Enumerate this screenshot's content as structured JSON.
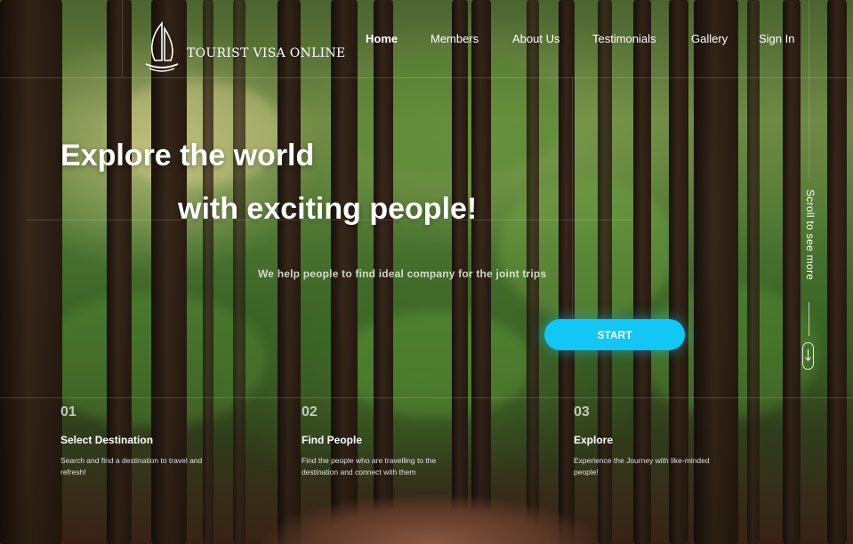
{
  "header": {
    "logo_text": "TOURIST VISA ONLINE",
    "nav": [
      {
        "label": "Home",
        "active": true
      },
      {
        "label": "Members",
        "active": false
      },
      {
        "label": "About Us",
        "active": false
      },
      {
        "label": "Testimonials",
        "active": false
      },
      {
        "label": "Gallery",
        "active": false
      },
      {
        "label": "Sign In",
        "active": false
      }
    ]
  },
  "hero": {
    "line1": "Explore the world",
    "line2": "with exciting people!",
    "subtitle": "We help people to find ideal company for the joint trips",
    "cta_label": "START"
  },
  "scroll_hint": "Scroll to see more",
  "features": [
    {
      "number": "01",
      "title": "Select Destination",
      "description": "Search and find a destination to travel and refresh!"
    },
    {
      "number": "02",
      "title": "Find People",
      "description": "Find the people who are travelling to the destination and connect with them"
    },
    {
      "number": "03",
      "title": "Explore",
      "description": "Experience the Journey with like-minded people!"
    }
  ],
  "colors": {
    "accent": "#14c6f6",
    "text": "#ffffff"
  },
  "icons": {
    "logo": "sail-boat-logo-icon",
    "scroll": "arrow-down-icon"
  }
}
